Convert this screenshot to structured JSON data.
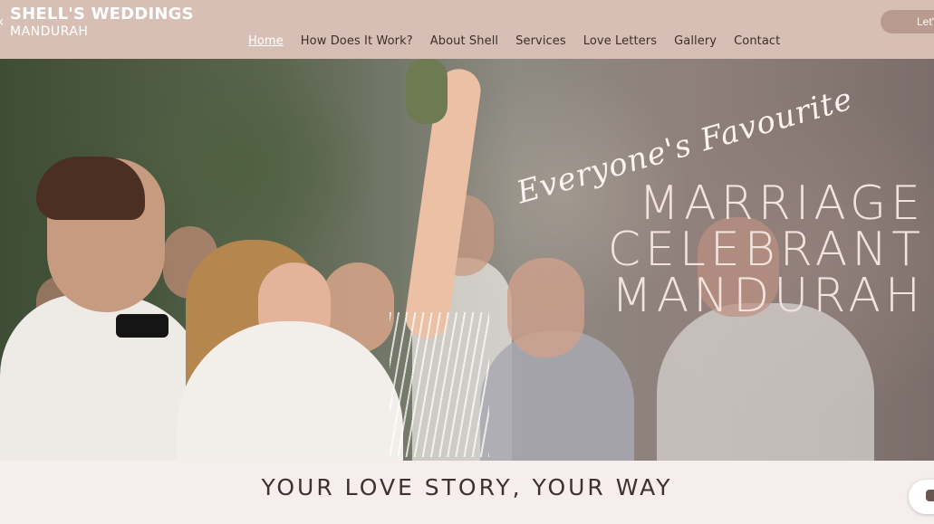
{
  "header": {
    "brand_name": "SHELL'S WEDDINGS",
    "brand_sub": "MANDURAH",
    "nav": [
      {
        "label": "Home",
        "active": true
      },
      {
        "label": "How Does It Work?"
      },
      {
        "label": "About Shell"
      },
      {
        "label": "Services"
      },
      {
        "label": "Love Letters"
      },
      {
        "label": "Gallery"
      },
      {
        "label": "Contact"
      }
    ],
    "cta_label": "Let'"
  },
  "hero": {
    "tagline": "Everyone's Favourite",
    "headline": [
      "MARRIAGE",
      "CELEBRANT",
      "MANDURAH"
    ]
  },
  "section": {
    "title": "YOUR LOVE STORY, YOUR WAY"
  },
  "colors": {
    "header_bg": "#d8bfb5",
    "page_bg": "#f6eeec",
    "heading_text": "#3f312d"
  },
  "icons": {
    "chat": "chat-icon"
  }
}
